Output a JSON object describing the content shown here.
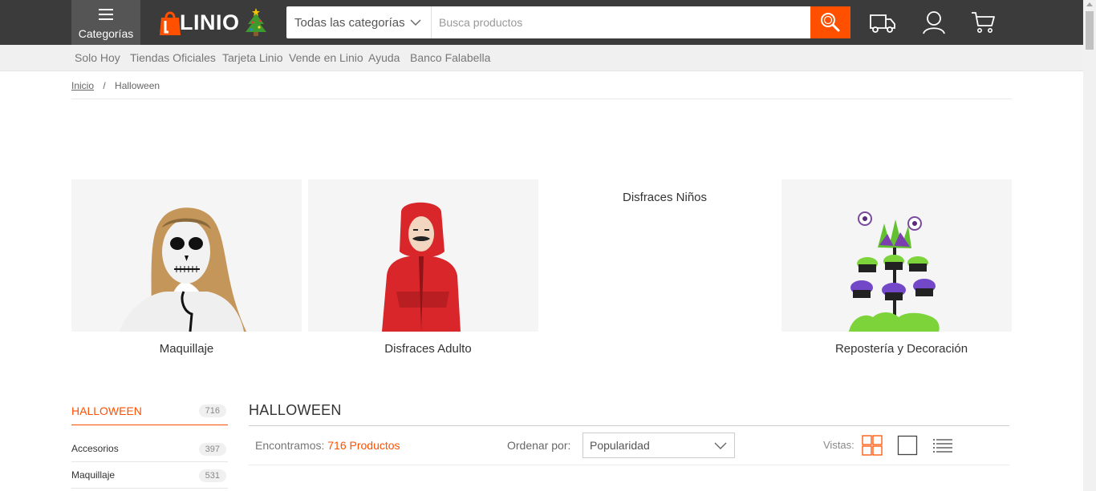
{
  "header": {
    "categories_label": "Categorías",
    "logo_text": "LINIO",
    "search": {
      "category": "Todas las categorías",
      "placeholder": "Busca productos"
    }
  },
  "subnav": [
    "Solo Hoy",
    "Tiendas Oficiales",
    "Tarjeta Linio",
    "Vende en Linio",
    "Ayuda",
    "Banco Falabella"
  ],
  "breadcrumb": {
    "home": "Inicio",
    "separator": "/",
    "current": "Halloween"
  },
  "featured": [
    {
      "label": "Maquillaje"
    },
    {
      "label": "Disfraces Adulto"
    },
    {
      "label": "Disfraces Niños"
    },
    {
      "label": "Repostería y Decoración"
    }
  ],
  "sidebar": {
    "title": "HALLOWEEN",
    "title_count": "716",
    "items": [
      {
        "label": "Accesorios",
        "count": "397"
      },
      {
        "label": "Maquillaje",
        "count": "531"
      }
    ]
  },
  "main": {
    "title": "HALLOWEEN",
    "found_prefix": "Encontramos:",
    "found_count": "716 Productos",
    "order_label": "Ordenar por:",
    "order_value": "Popularidad",
    "views_label": "Vistas:"
  },
  "colors": {
    "accent": "#ff5000",
    "topbar": "#3b3b3b"
  }
}
